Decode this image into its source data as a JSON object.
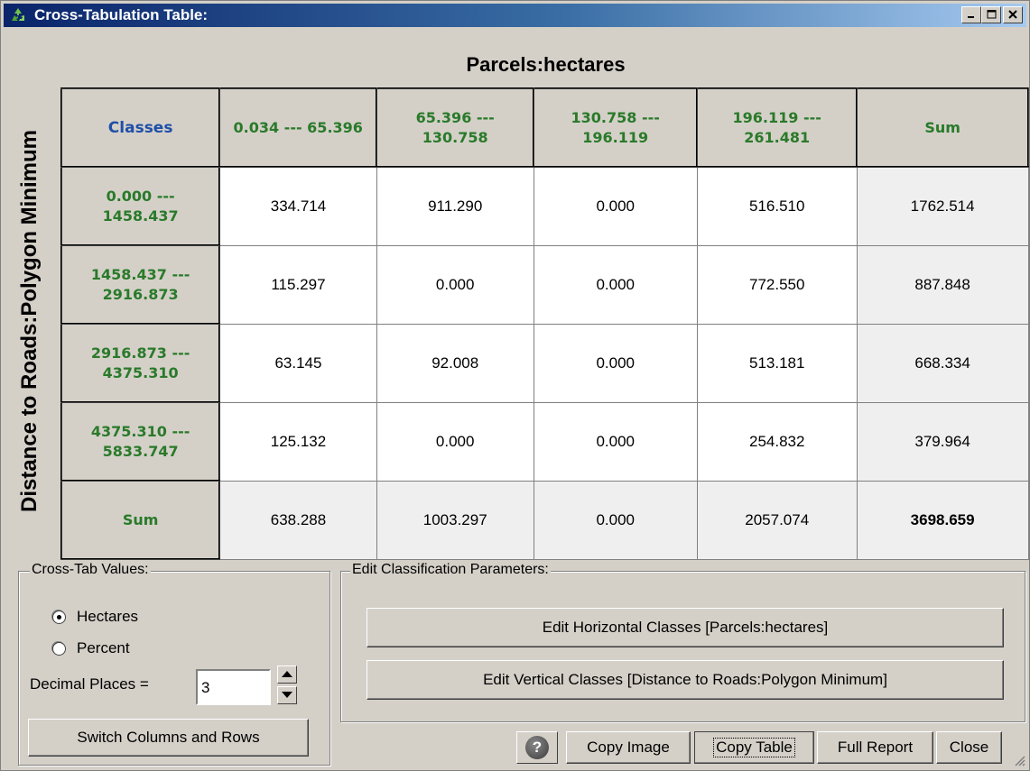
{
  "window": {
    "title": "Cross-Tabulation Table:"
  },
  "titlebar_buttons": {
    "minimize": "_",
    "maximize": "□",
    "close": "×"
  },
  "table": {
    "horizontal_title": "Parcels:hectares",
    "vertical_title": "Distance to Roads:Polygon Minimum",
    "corner_label": "Classes",
    "columns": [
      [
        "0.034 --- 65.396"
      ],
      [
        "65.396 ---",
        "130.758"
      ],
      [
        "130.758 ---",
        "196.119"
      ],
      [
        "196.119 ---",
        "261.481"
      ],
      [
        "Sum"
      ]
    ],
    "rows": [
      {
        "label": [
          "0.000 ---",
          "1458.437"
        ],
        "cells": [
          "334.714",
          "911.290",
          "0.000",
          "516.510",
          "1762.514"
        ]
      },
      {
        "label": [
          "1458.437 ---",
          "2916.873"
        ],
        "cells": [
          "115.297",
          "0.000",
          "0.000",
          "772.550",
          "887.848"
        ]
      },
      {
        "label": [
          "2916.873 ---",
          "4375.310"
        ],
        "cells": [
          "63.145",
          "92.008",
          "0.000",
          "513.181",
          "668.334"
        ]
      },
      {
        "label": [
          "4375.310 ---",
          "5833.747"
        ],
        "cells": [
          "125.132",
          "0.000",
          "0.000",
          "254.832",
          "379.964"
        ]
      },
      {
        "label": [
          "Sum"
        ],
        "cells": [
          "638.288",
          "1003.297",
          "0.000",
          "2057.074",
          "3698.659"
        ]
      }
    ]
  },
  "crosstab_values": {
    "legend": "Cross-Tab Values:",
    "options": [
      {
        "label": "Hectares",
        "selected": true
      },
      {
        "label": "Percent",
        "selected": false
      }
    ],
    "decimal_label": "Decimal Places =",
    "decimal_value": "3",
    "switch_button": "Switch Columns and Rows"
  },
  "edit_classification": {
    "legend": "Edit Classification Parameters:",
    "horizontal_button": "Edit Horizontal Classes [Parcels:hectares]",
    "vertical_button": "Edit Vertical Classes [Distance to Roads:Polygon Minimum]"
  },
  "footer": {
    "help": "?",
    "copy_image": "Copy Image",
    "copy_table": "Copy Table",
    "full_report": "Full Report",
    "close": "Close"
  }
}
